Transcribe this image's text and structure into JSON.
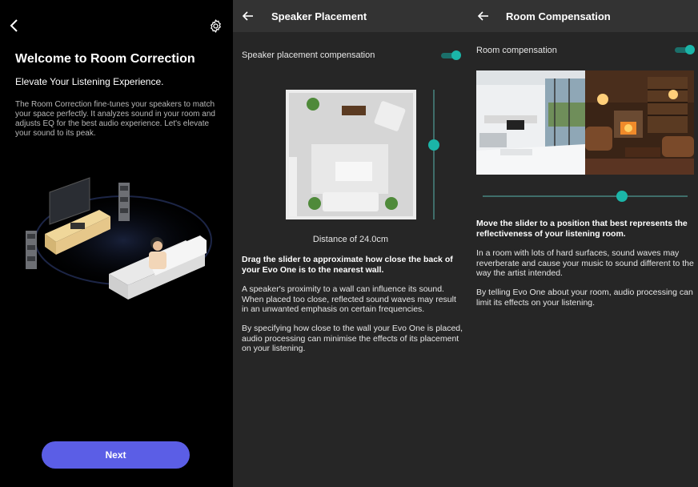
{
  "panel1": {
    "title": "Welcome to Room Correction",
    "subtitle": "Elevate Your Listening Experience.",
    "description": "The Room Correction fine-tunes your speakers to match your space perfectly. It analyzes sound in your room and adjusts EQ for the best audio experience. Let's elevate your sound to its peak.",
    "next_label": "Next",
    "back_icon": "chevron-left-icon",
    "settings_icon": "gear-icon"
  },
  "panel2": {
    "title": "Speaker Placement",
    "toggle_label": "Speaker placement compensation",
    "toggle_on": true,
    "slider_level": 0.42,
    "distance_text": "Distance of 24.0cm",
    "instruction": "Drag the slider to approximate how close the back of your Evo One is to the nearest wall.",
    "para1": "A speaker's proximity to a wall can influence its sound. When placed too close, reflected sound waves may result in an unwanted emphasis on certain frequencies.",
    "para2": "By specifying how close to the wall your Evo One is placed, audio processing can minimise the effects of its placement on your listening."
  },
  "panel3": {
    "title": "Room Compensation",
    "toggle_label": "Room compensation",
    "toggle_on": true,
    "slider_level": 0.69,
    "instruction": "Move the slider to a position that best represents the reflectiveness of your listening room.",
    "para1": "In a room with lots of hard surfaces, sound waves may reverberate and cause your music to sound different to the way the artist intended.",
    "para2": "By telling Evo One about your room, audio processing can limit its effects on your listening."
  },
  "colors": {
    "accent": "#1bb5a8",
    "button": "#5b5ee6",
    "panel_bg": "#262626",
    "header_bg": "#333333"
  }
}
